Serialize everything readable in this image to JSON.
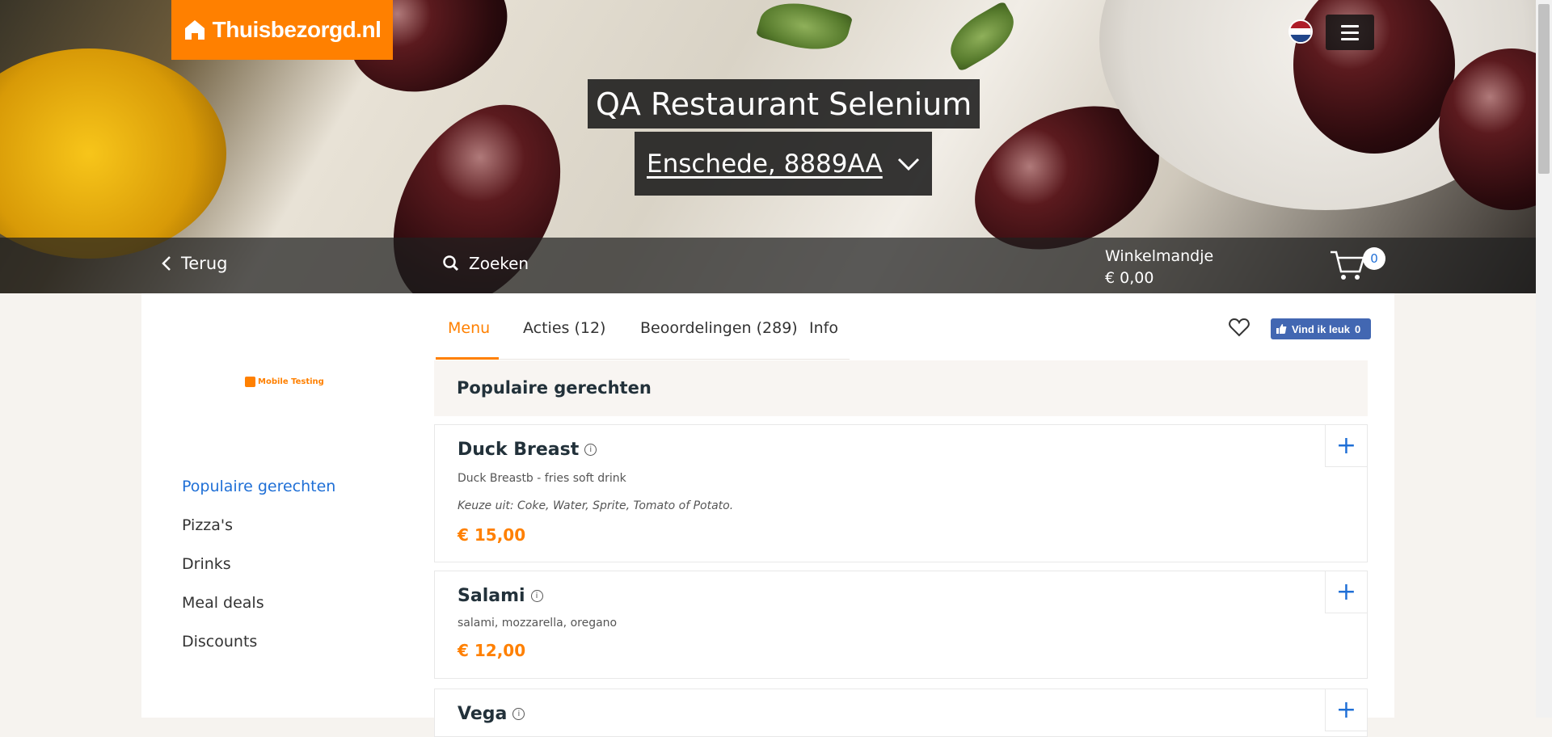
{
  "brand": {
    "name": "Thuisbezorgd.nl",
    "color": "#ff8000"
  },
  "restaurant": {
    "name": "QA Restaurant Selenium",
    "address": "Enschede, 8889AA"
  },
  "nav": {
    "back_label": "Terug",
    "search_label": "Zoeken"
  },
  "cart": {
    "label": "Winkelmandje",
    "total": "€ 0,00",
    "count": "0"
  },
  "sidebar": {
    "logo_text": "Mobile Testing",
    "categories": [
      {
        "label": "Populaire gerechten",
        "active": true
      },
      {
        "label": "Pizza's"
      },
      {
        "label": "Drinks"
      },
      {
        "label": "Meal deals"
      },
      {
        "label": "Discounts"
      }
    ]
  },
  "tabs": [
    {
      "label": "Menu",
      "active": true
    },
    {
      "label": "Acties (12)"
    },
    {
      "label": "Beoordelingen (289)"
    },
    {
      "label": "Info"
    }
  ],
  "facebook": {
    "like_label": "Vind ik leuk",
    "count": "0"
  },
  "section": {
    "title": "Populaire gerechten"
  },
  "dishes": [
    {
      "name": "Duck Breast",
      "description": "Duck Breastb - fries soft drink",
      "choice": "Keuze uit: Coke, Water, Sprite, Tomato of Potato.",
      "price": "€ 15,00"
    },
    {
      "name": "Salami",
      "description": "salami, mozzarella, oregano",
      "price": "€ 12,00"
    },
    {
      "name": "Vega"
    }
  ],
  "icons": {
    "add": "plus-icon",
    "info": "info-icon",
    "favorite": "heart-icon",
    "cart": "cart-icon",
    "menu": "hamburger-icon",
    "language": "dutch-flag-icon"
  }
}
